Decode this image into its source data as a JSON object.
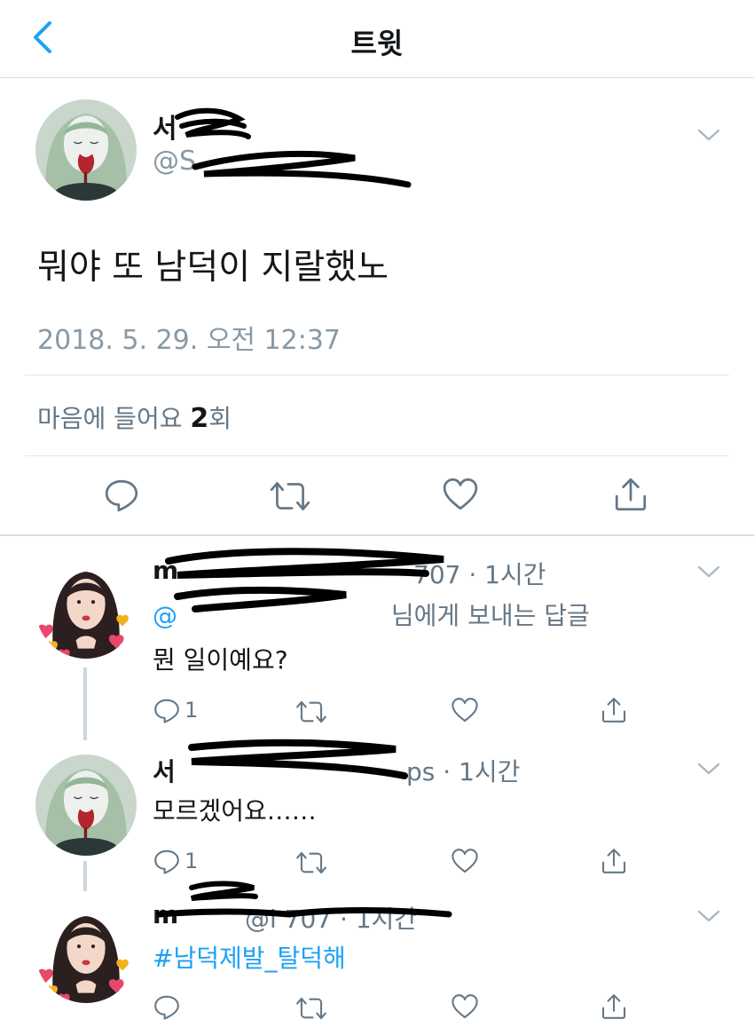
{
  "header": {
    "title": "트윗"
  },
  "main_tweet": {
    "name": "서",
    "handle": "@S",
    "text": "뭐야 또 남덕이 지랄했노",
    "timestamp": "2018. 5. 29. 오전 12:37",
    "likes_prefix": "마음에 들어요 ",
    "likes_count": "2",
    "likes_suffix": "회"
  },
  "replies": [
    {
      "name": "m",
      "meta": "707 · 1시간",
      "reply_to_mention": "@",
      "reply_to_suffix": " 님에게 보내는 답글",
      "text": "뭔 일이예요?",
      "reply_count": "1"
    },
    {
      "name": "서",
      "meta": "ps · 1시간",
      "text": "모르겠어요……",
      "reply_count": "1"
    },
    {
      "name": "m",
      "meta": "@l 707 · 1시간",
      "text": "#남덕제발_탈덕해",
      "reply_count": ""
    }
  ],
  "colors": {
    "accent": "#1da1f2",
    "secondary_text": "#8899a6",
    "divider": "#e1e8ed",
    "icon": "#657786"
  }
}
